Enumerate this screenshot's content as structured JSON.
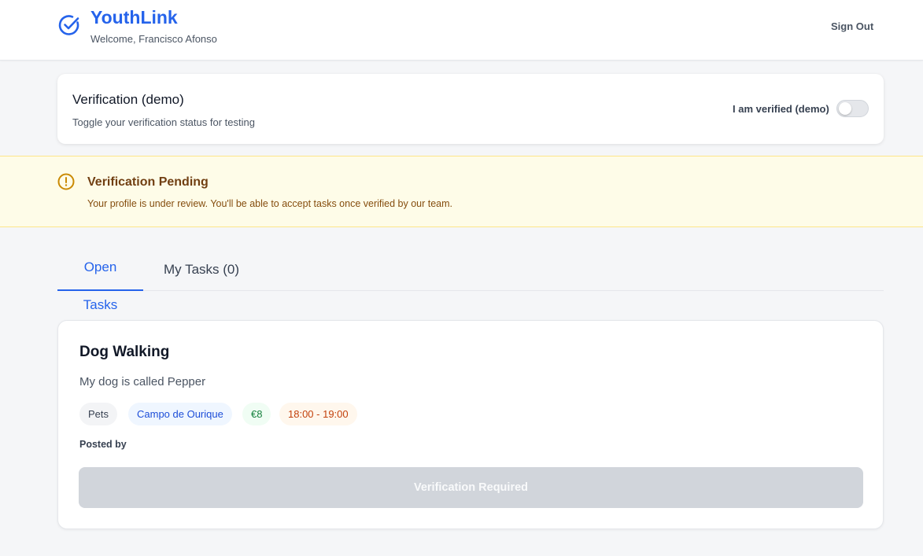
{
  "header": {
    "brand": "YouthLink",
    "welcome": "Welcome, Francisco Afonso",
    "logo_icon": "check-circle-icon",
    "signout_label": "Sign Out",
    "brand_color": "#2563eb"
  },
  "verification": {
    "title": "Verification (demo)",
    "subtitle": "Toggle your verification status for testing",
    "toggle_label": "I am verified (demo)",
    "toggle_on": false
  },
  "banner": {
    "icon": "alert-circle-icon",
    "title": "Verification Pending",
    "text": "Your profile is under review. You'll be able to accept tasks once verified by our team.",
    "accent_color": "#ca8a04"
  },
  "tabs": [
    {
      "label": "Open Tasks",
      "active": true
    },
    {
      "label": "My Tasks (0)",
      "active": false
    }
  ],
  "tasks": [
    {
      "title": "Dog Walking",
      "description": "My dog is called Pepper",
      "category": "Pets",
      "location": "Campo de Ourique",
      "price": "€8",
      "time": "18:00 - 19:00",
      "posted_by": "Posted by",
      "action_label": "Verification Required"
    }
  ]
}
